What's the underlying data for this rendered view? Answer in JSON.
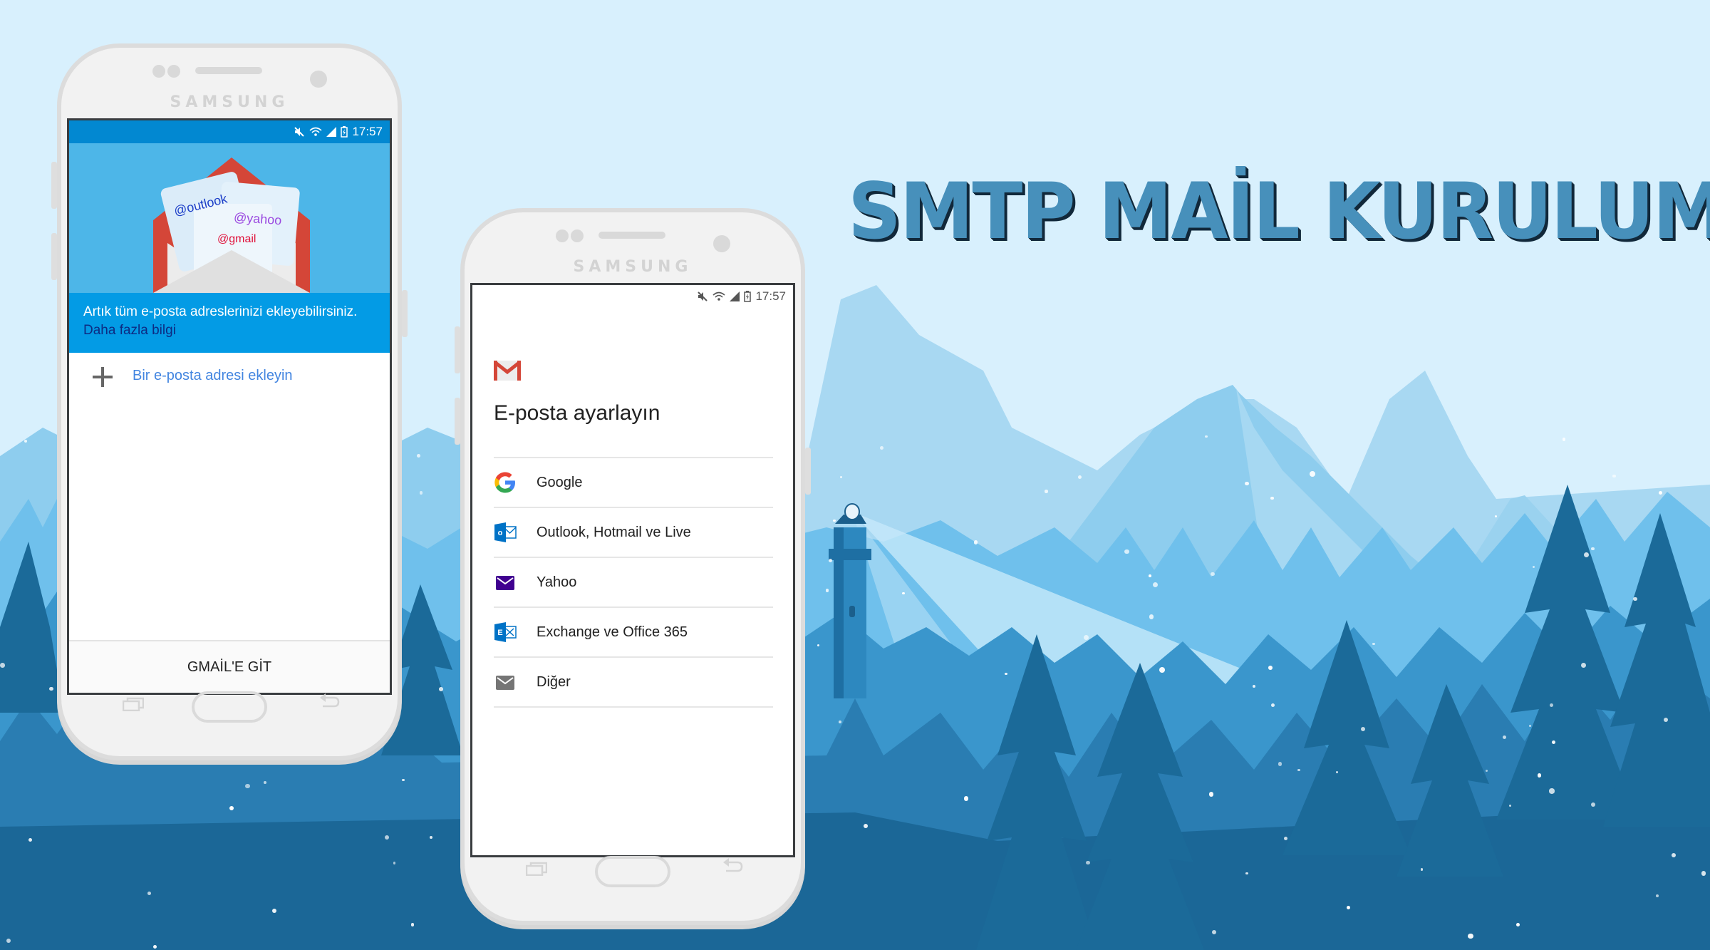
{
  "page": {
    "title": "SMTP MAİL KURULUMU",
    "colors": {
      "sky": "#d8f0fd",
      "title_fill": "#4790bb",
      "title_shadow": "#11283a",
      "gmail_red": "#d44638",
      "status_blue": "#0288d1",
      "info_band_blue": "#039be5",
      "link_blue": "#4285e0"
    }
  },
  "phone_left": {
    "brand": "SAMSUNG",
    "status_bar": {
      "time": "17:57",
      "icons": [
        "mute-icon",
        "wifi-icon",
        "signal-icon",
        "battery-charging-icon"
      ]
    },
    "hero": {
      "cards": [
        "@outlook",
        "@yahoo",
        "@gmail"
      ]
    },
    "info_band": {
      "message": "Artık tüm e-posta adreslerinizi ekleyebilirsiniz.",
      "link": "Daha fazla bilgi"
    },
    "add_account": {
      "icon": "plus-icon",
      "label": "Bir e-posta adresi ekleyin"
    },
    "footer_button": "GMAİL'E GİT",
    "nav": [
      "recent-apps-icon",
      "home-button",
      "back-icon"
    ]
  },
  "phone_right": {
    "brand": "SAMSUNG",
    "status_bar": {
      "time": "17:57",
      "icons": [
        "mute-icon",
        "wifi-icon",
        "signal-icon",
        "battery-charging-icon"
      ]
    },
    "heading": "E-posta ayarlayın",
    "providers": [
      {
        "label": "Google",
        "icon": "google-icon"
      },
      {
        "label": "Outlook, Hotmail ve Live",
        "icon": "outlook-icon"
      },
      {
        "label": "Yahoo",
        "icon": "yahoo-mail-icon"
      },
      {
        "label": "Exchange ve Office 365",
        "icon": "exchange-icon"
      },
      {
        "label": "Diğer",
        "icon": "other-mail-icon"
      }
    ],
    "nav": [
      "recent-apps-icon",
      "home-button",
      "back-icon"
    ]
  }
}
